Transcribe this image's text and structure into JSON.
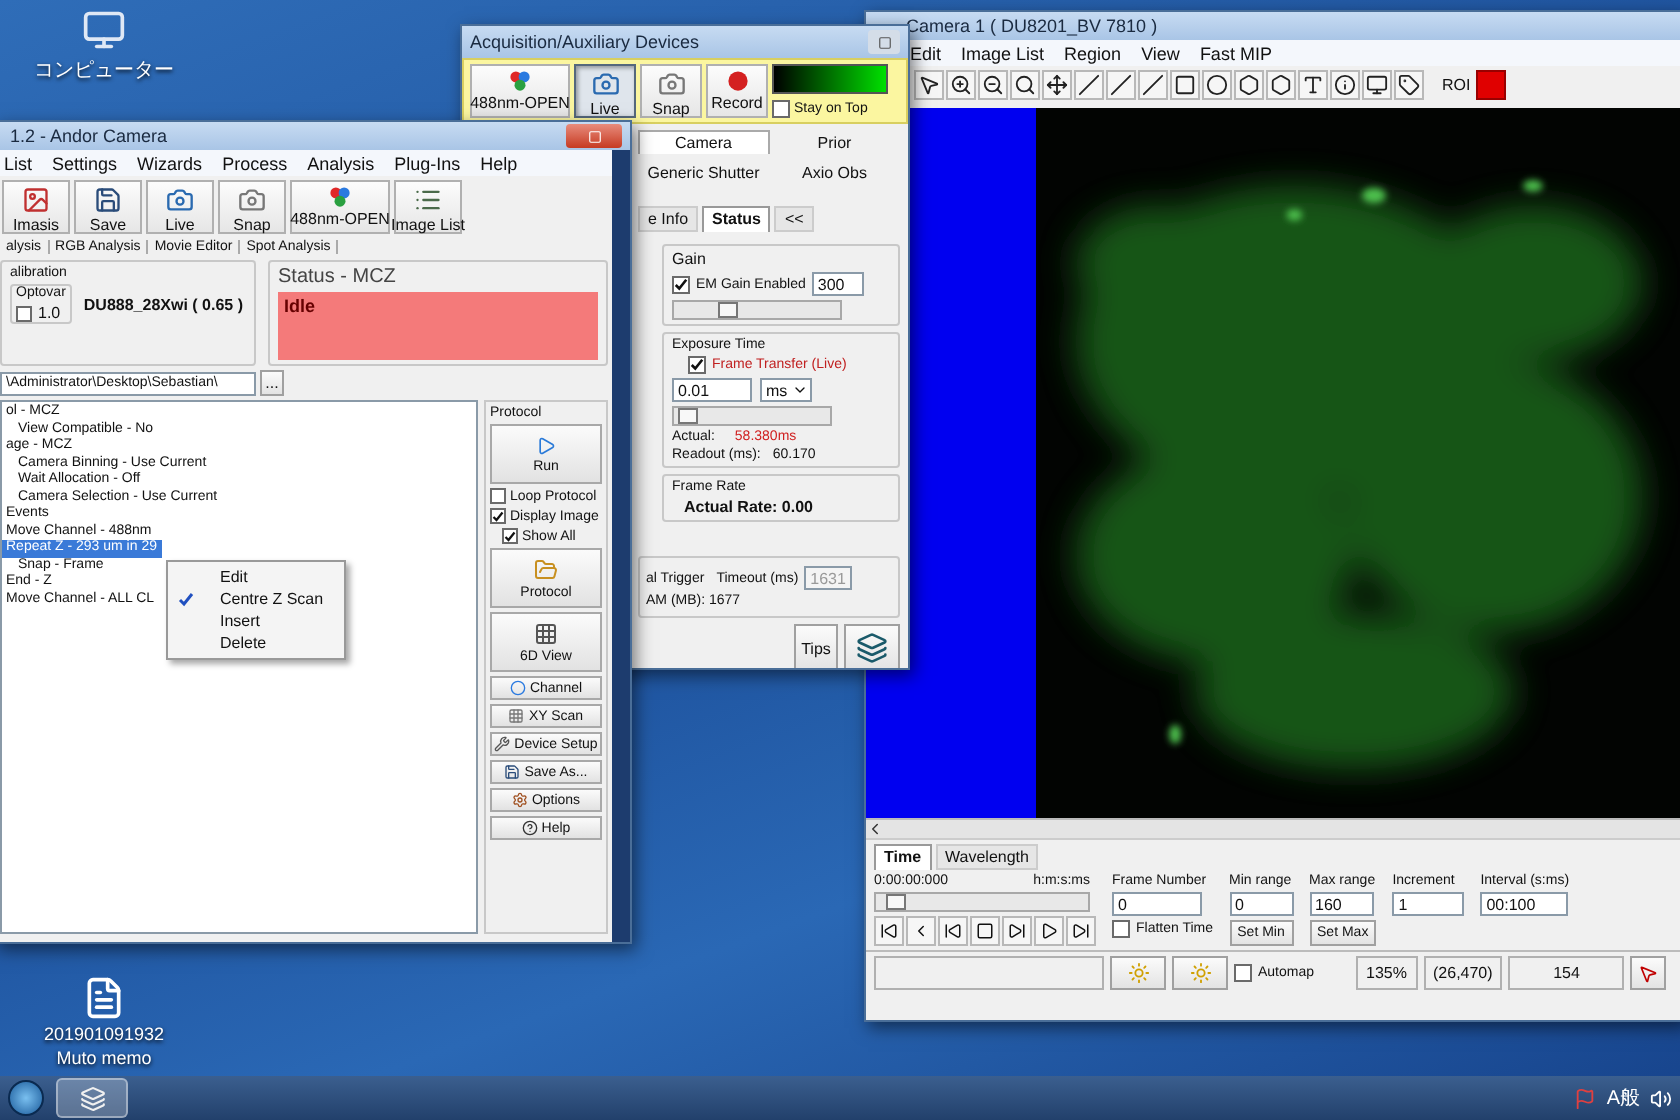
{
  "desktop_icons": [
    {
      "kind": "computer",
      "lines": [
        "コンピューター"
      ]
    },
    {
      "kind": "document",
      "lines": [
        "201901091932",
        "Muto memo"
      ]
    }
  ],
  "camera_window": {
    "title": "Camera 1 ( DU8201_BV 7810 )",
    "menu": [
      "Edit",
      "Image List",
      "Region",
      "View",
      "Fast MIP"
    ],
    "roi": "ROI",
    "tabs": [
      {
        "label": "Time",
        "selected": true
      },
      {
        "label": "Wavelength",
        "selected": false
      }
    ],
    "time": {
      "value": "0:00:00:000",
      "format": "h:m:s:ms",
      "level": 0.05
    },
    "frame": {
      "label": "Frame Number",
      "value": "0"
    },
    "flatten": {
      "label": "Flatten Time",
      "checked": false
    },
    "min_range": {
      "label": "Min range",
      "value": "0",
      "button": "Set Min"
    },
    "max_range": {
      "label": "Max range",
      "value": "160",
      "button": "Set Max"
    },
    "increment": {
      "label": "Increment",
      "value": "1"
    },
    "interval": {
      "label": "Interval (s:ms)",
      "value": "00:100"
    },
    "status_bar": {
      "automap": {
        "label": "Automap",
        "checked": false
      },
      "zoom": "135%",
      "position": "(26,470)",
      "value": "154"
    }
  },
  "acquisition_window": {
    "title": "Acquisition/Auxiliary Devices",
    "toolbar": [
      {
        "kind": "channel",
        "label": "488nm-OPEN",
        "pressed": false
      },
      {
        "kind": "live",
        "label": "Live",
        "pressed": true
      },
      {
        "kind": "snap",
        "label": "Snap",
        "pressed": false
      },
      {
        "kind": "record",
        "label": "Record",
        "pressed": false
      }
    ],
    "stay_on_top": {
      "label": "Stay on Top",
      "checked": false
    },
    "device_tabs": [
      {
        "label": "Camera",
        "selected": true
      },
      {
        "label": "Prior",
        "selected": false
      },
      {
        "label": "Generic Shutter",
        "selected": false
      },
      {
        "label": "Axio Obs",
        "selected": false
      }
    ],
    "sub_tabs": [
      {
        "label": "e Info",
        "selected": false
      },
      {
        "label": "Status",
        "selected": true
      },
      {
        "label": "<<",
        "selected": false
      }
    ],
    "gain": {
      "title": "Gain",
      "label": "EM Gain Enabled",
      "checked": true,
      "value": "300",
      "level": 0.3
    },
    "exposure": {
      "title": "Exposure Time",
      "label": "Frame Transfer (Live)",
      "checked": true,
      "value": "0.01",
      "unit": "ms",
      "level": 0.03,
      "actual_label": "Actual:",
      "actual": "58.380ms",
      "readout_label": "Readout (ms):",
      "readout": "60.170"
    },
    "frame_rate": {
      "title": "Frame Rate",
      "text": "Actual Rate: 0.00"
    },
    "trigger": {
      "mode": "al Trigger",
      "timeout_label": "Timeout (ms)",
      "timeout": "1631",
      "ram": "AM (MB): 1677"
    },
    "tips": "Tips"
  },
  "andor_window": {
    "title": "1.2  - Andor Camera",
    "menu": [
      "List",
      "Settings",
      "Wizards",
      "Process",
      "Analysis",
      "Plug-Ins",
      "Help"
    ],
    "toolbar": [
      {
        "kind": "image",
        "label": "Imasis"
      },
      {
        "kind": "save",
        "label": "Save"
      },
      {
        "kind": "live",
        "label": "Live"
      },
      {
        "kind": "snap",
        "label": "Snap"
      },
      {
        "kind": "channel",
        "label": "488nm-OPEN"
      },
      {
        "kind": "list",
        "label": "Image List"
      }
    ],
    "tabs": [
      "alysis",
      "RGB Analysis",
      "Movie Editor",
      "Spot Analysis"
    ],
    "calibration": {
      "title": "alibration",
      "optovar_label": "Optovar",
      "checked": false,
      "optovar": "1.0",
      "objective": "DU888_28Xwi ( 0.65 )"
    },
    "status": {
      "title": "Status - MCZ",
      "text": "Idle"
    },
    "path": {
      "value": "\\Administrator\\Desktop\\Sebastian\\",
      "browse": "..."
    },
    "tree": [
      {
        "label": "ol - MCZ",
        "selected": false,
        "children": [
          {
            "label": "View Compatible - No",
            "selected": false
          }
        ]
      },
      {
        "label": "age - MCZ",
        "selected": false,
        "children": [
          {
            "label": "Camera Binning - Use Current",
            "selected": false
          },
          {
            "label": "Wait Allocation - Off",
            "selected": false
          },
          {
            "label": "Camera Selection - Use Current",
            "selected": false
          }
        ]
      },
      {
        "label": "Events",
        "selected": false
      },
      {
        "label": "Move Channel - 488nm",
        "selected": false
      },
      {
        "label": "Repeat Z - 293 um in 29",
        "selected": true,
        "children": [
          {
            "label": "Snap - Frame",
            "selected": false
          }
        ]
      },
      {
        "label": "End - Z",
        "selected": false
      },
      {
        "label": "Move Channel - ALL CL",
        "selected": false
      }
    ],
    "context_menu": [
      {
        "label": "Edit",
        "checked": false
      },
      {
        "label": "Centre Z Scan",
        "checked": true
      },
      {
        "label": "Insert",
        "checked": false
      },
      {
        "label": "Delete",
        "checked": false
      }
    ],
    "protocol": {
      "title": "Protocol",
      "run": "Run",
      "options": [
        {
          "label": "Loop Protocol",
          "checked": false
        },
        {
          "label": "Display Image",
          "checked": true,
          "children": [
            {
              "label": "Show All",
              "checked": true
            }
          ]
        }
      ],
      "buttons": [
        {
          "kind": "protocol",
          "label": "Protocol"
        },
        {
          "kind": "view6d",
          "label": "6D View"
        },
        {
          "kind": "channel",
          "label": "Channel"
        },
        {
          "kind": "xy",
          "label": "XY Scan"
        },
        {
          "kind": "setup",
          "label": "Device Setup"
        },
        {
          "kind": "save",
          "label": "Save As..."
        },
        {
          "kind": "options",
          "label": "Options"
        },
        {
          "kind": "help",
          "label": "Help"
        }
      ]
    }
  },
  "taskbar": {
    "ime": "A般"
  }
}
